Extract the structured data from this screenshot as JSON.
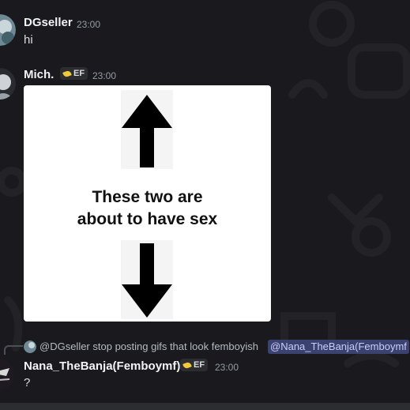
{
  "messages": [
    {
      "username": "DGseller",
      "timestamp": "23:00",
      "text": "hi"
    },
    {
      "username": "Mich.",
      "badge": "EF",
      "timestamp": "23:00",
      "image": {
        "alt": "meme",
        "caption": "These two are about to have sex"
      }
    },
    {
      "username": "Nana_TheBanja(Femboymf)",
      "badge": "EF",
      "timestamp": "23:00",
      "text": "?",
      "reply": {
        "author": "@DGseller",
        "text": "stop posting gifs that look femboyish",
        "mention": "@Nana_TheBanja(Femboymf"
      }
    }
  ]
}
